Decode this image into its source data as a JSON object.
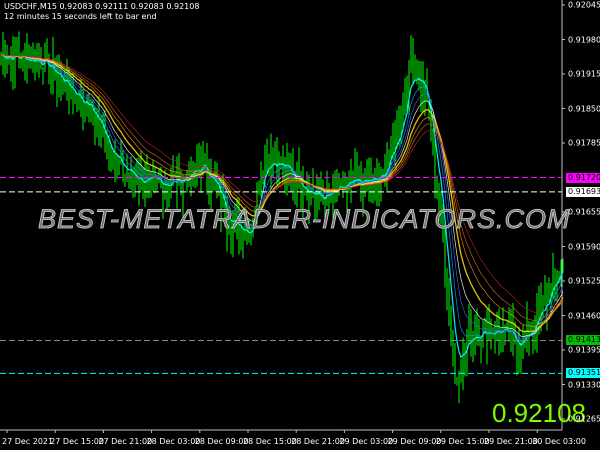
{
  "header": {
    "symbol_line": "USDCHF,M15  0.92083 0.92111 0.92083 0.92108",
    "timer": "12 minutes 15 seconds left to bar end"
  },
  "big_price": "0.92108",
  "watermark": "BEST-METATRADER-INDICATORS.COM",
  "colors": {
    "candles": "#00ff00",
    "magenta": "#ff00ff",
    "cyan": "#00ffff",
    "bid": "#7cfc00"
  },
  "chart_data": {
    "type": "line",
    "symbol": "USDCHF",
    "timeframe": "M15",
    "price_ticks": [
      "0.92045",
      "0.91980",
      "0.91915",
      "0.91850",
      "0.91785",
      "0.91655",
      "0.91590",
      "0.91525",
      "0.91460",
      "0.91395",
      "0.91330",
      "0.91265"
    ],
    "time_ticks": [
      "27 Dec 2021",
      "27 Dec 15:00",
      "27 Dec 21:00",
      "28 Dec 03:00",
      "28 Dec 09:00",
      "28 Dec 15:00",
      "28 Dec 21:00",
      "29 Dec 03:00",
      "29 Dec 09:00",
      "29 Dec 15:00",
      "29 Dec 21:00",
      "30 Dec 03:00"
    ],
    "ylim": [
      0.91245,
      0.92055
    ],
    "closes_anchor": [
      [
        0,
        0.91951
      ],
      [
        20,
        0.91941
      ],
      [
        30,
        0.91904
      ],
      [
        45,
        0.91847
      ],
      [
        60,
        0.91734
      ],
      [
        75,
        0.91706
      ],
      [
        90,
        0.91715
      ],
      [
        102,
        0.91744
      ],
      [
        115,
        0.9163
      ],
      [
        125,
        0.91621
      ],
      [
        132,
        0.91772
      ],
      [
        145,
        0.91725
      ],
      [
        160,
        0.91678
      ],
      [
        175,
        0.91706
      ],
      [
        190,
        0.91715
      ],
      [
        200,
        0.91828
      ],
      [
        205,
        0.91941
      ],
      [
        212,
        0.91885
      ],
      [
        220,
        0.9164
      ],
      [
        227,
        0.91338
      ],
      [
        235,
        0.91432
      ],
      [
        250,
        0.91432
      ],
      [
        260,
        0.91404
      ],
      [
        270,
        0.9147
      ],
      [
        281,
        0.91564
      ]
    ],
    "hlines": [
      {
        "price": "0.91720",
        "color": "#ff00ff",
        "text_color": "#000"
      },
      {
        "price": "0.91693",
        "color": "#ffffff",
        "text_color": "#000"
      },
      {
        "price": "0.91413",
        "color": "#00c000",
        "text_color": "#000"
      },
      {
        "price": "0.91351",
        "color": "#00ffff",
        "text_color": "#000"
      }
    ]
  }
}
